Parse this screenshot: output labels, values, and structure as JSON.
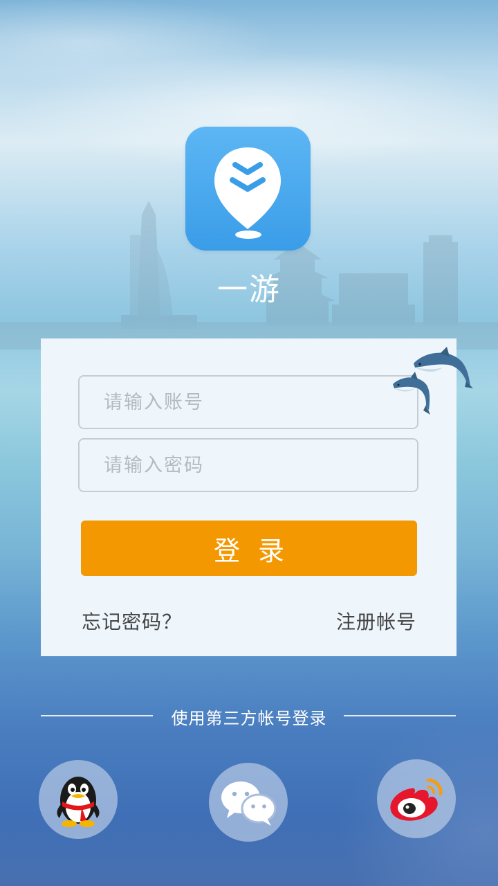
{
  "app": {
    "name": "一游",
    "brand_color": "#3a9de8",
    "accent_color": "#f39800"
  },
  "login_form": {
    "account_placeholder": "请输入账号",
    "password_placeholder": "请输入密码",
    "login_label": "登录",
    "forgot_password": "忘记密码？",
    "register": "注册帐号"
  },
  "third_party": {
    "title": "使用第三方帐号登录",
    "providers": [
      {
        "name": "QQ",
        "icon": "qq-penguin-icon"
      },
      {
        "name": "WeChat",
        "icon": "wechat-icon"
      },
      {
        "name": "Weibo",
        "icon": "weibo-icon"
      }
    ]
  }
}
